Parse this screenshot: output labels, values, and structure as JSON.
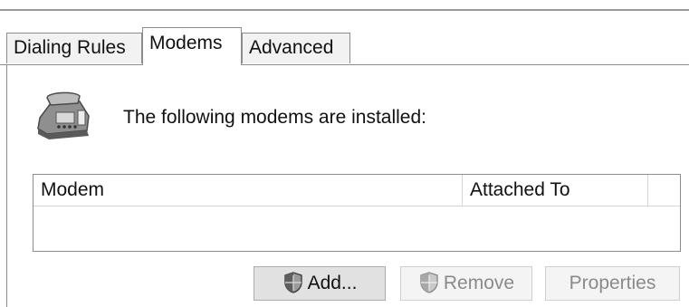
{
  "tabs": [
    {
      "label": "Dialing Rules",
      "active": false
    },
    {
      "label": "Modems",
      "active": true
    },
    {
      "label": "Advanced",
      "active": false
    }
  ],
  "panel": {
    "intro_text": "The following modems are installed:",
    "icon": "telephone-modem-icon"
  },
  "modem_list": {
    "columns": [
      "Modem",
      "Attached To"
    ],
    "rows": []
  },
  "buttons": {
    "add": {
      "label": "Add...",
      "icon": "uac-shield-icon",
      "enabled": true
    },
    "remove": {
      "label": "Remove",
      "icon": "uac-shield-icon",
      "enabled": false
    },
    "properties": {
      "label": "Properties",
      "enabled": false
    }
  }
}
